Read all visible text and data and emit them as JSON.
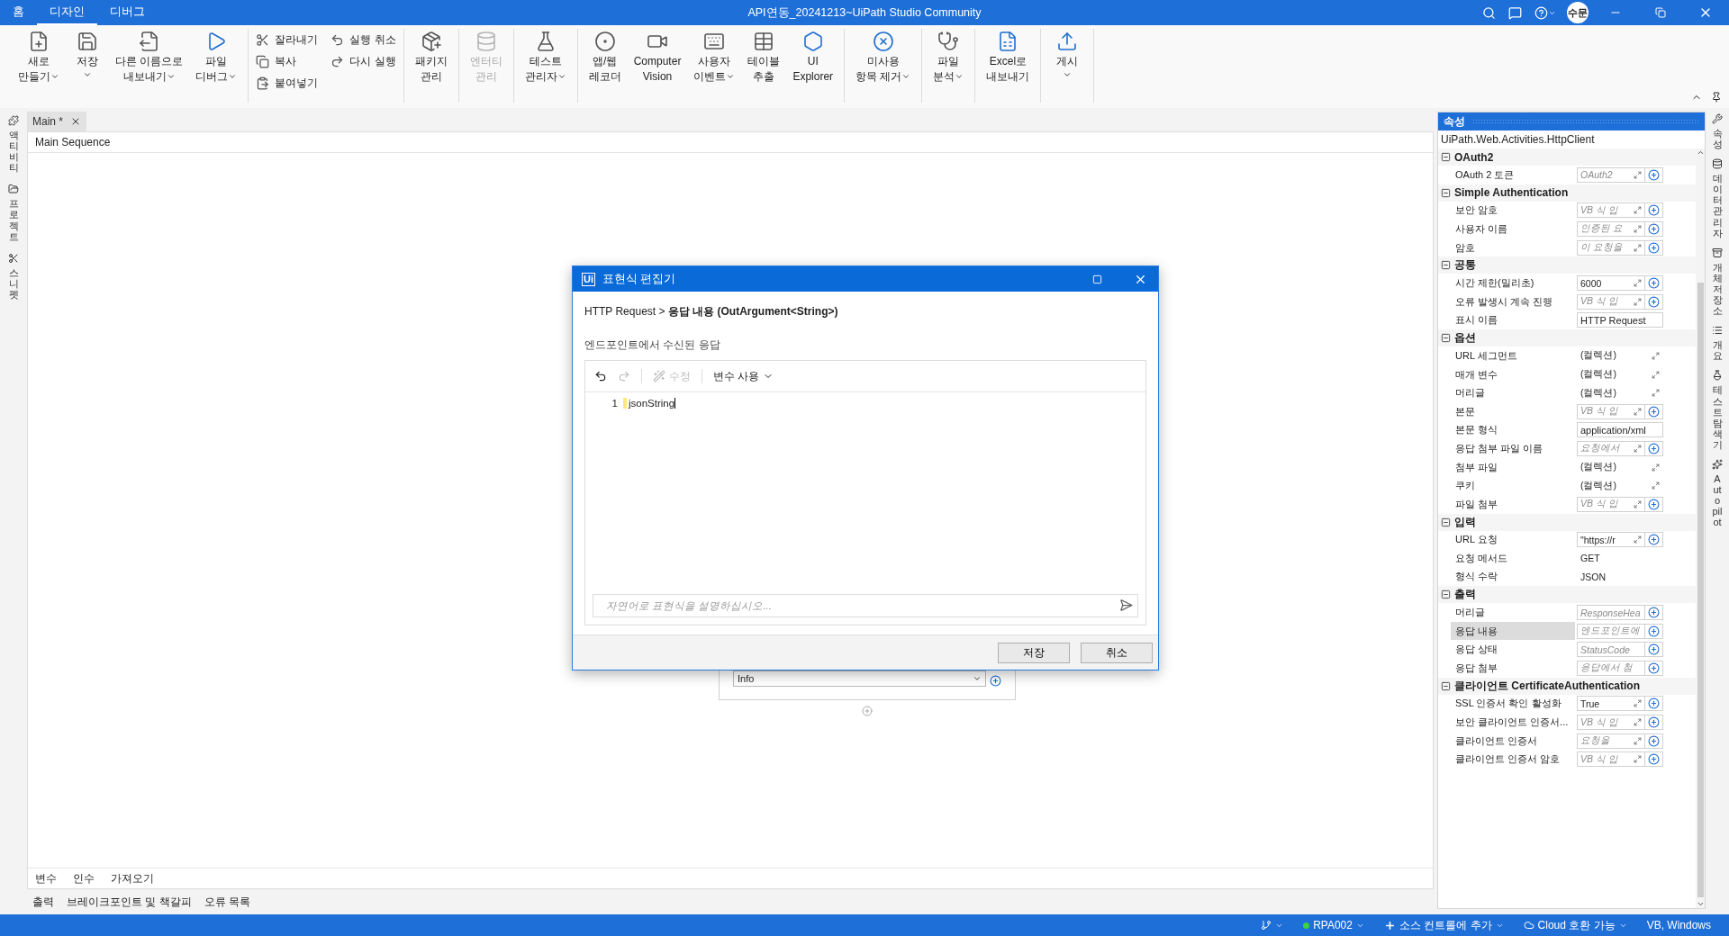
{
  "window": {
    "title": "API연동_20241213~UiPath Studio Community",
    "user": "수문"
  },
  "menu_tabs": [
    {
      "label": "홈",
      "selected": false
    },
    {
      "label": "디자인",
      "selected": true
    },
    {
      "label": "디버그",
      "selected": false
    }
  ],
  "ribbon_groups": [
    {
      "kind": "large",
      "buttons": [
        {
          "lines": [
            "새로",
            "만들기"
          ],
          "caret": true,
          "disabled": false
        },
        {
          "lines": [
            "저장"
          ],
          "caret": true,
          "disabled": false
        },
        {
          "lines": [
            "다른 이름으로",
            "내보내기"
          ],
          "caret": true,
          "disabled": false
        },
        {
          "lines": [
            "파일",
            "디버그"
          ],
          "caret": true,
          "disabled": false
        }
      ]
    },
    {
      "kind": "small",
      "buttons": [
        {
          "label": "잘라내기",
          "disabled": false
        },
        {
          "label": "복사",
          "disabled": false
        },
        {
          "label": "붙여넣기",
          "disabled": false
        },
        {
          "label": "실행 취소",
          "disabled": false
        },
        {
          "label": "다시 실행",
          "disabled": false
        }
      ]
    },
    {
      "kind": "large",
      "buttons": [
        {
          "lines": [
            "패키지",
            "관리"
          ],
          "caret": false,
          "disabled": false
        }
      ]
    },
    {
      "kind": "large",
      "buttons": [
        {
          "lines": [
            "엔터티",
            "관리"
          ],
          "caret": false,
          "disabled": true
        }
      ]
    },
    {
      "kind": "large",
      "buttons": [
        {
          "lines": [
            "테스트",
            "관리자"
          ],
          "caret": true,
          "disabled": false
        }
      ]
    },
    {
      "kind": "large",
      "buttons": [
        {
          "lines": [
            "앱/웹",
            "레코더"
          ],
          "caret": false,
          "disabled": false
        },
        {
          "lines": [
            "Computer",
            "Vision"
          ],
          "caret": false,
          "disabled": false
        },
        {
          "lines": [
            "사용자",
            "이벤트"
          ],
          "caret": true,
          "disabled": false
        },
        {
          "lines": [
            "테이블",
            "추출"
          ],
          "caret": false,
          "disabled": false
        },
        {
          "lines": [
            "UI",
            "Explorer"
          ],
          "caret": false,
          "disabled": false
        }
      ]
    },
    {
      "kind": "large",
      "buttons": [
        {
          "lines": [
            "미사용",
            "항목 제거"
          ],
          "caret": true,
          "disabled": false
        }
      ]
    },
    {
      "kind": "large",
      "buttons": [
        {
          "lines": [
            "파일",
            "분석"
          ],
          "caret": true,
          "disabled": false
        }
      ]
    },
    {
      "kind": "large",
      "buttons": [
        {
          "lines": [
            "Excel로",
            "내보내기"
          ],
          "caret": false,
          "disabled": false
        }
      ]
    },
    {
      "kind": "large",
      "buttons": [
        {
          "lines": [
            "게시"
          ],
          "caret": true,
          "disabled": false
        }
      ]
    }
  ],
  "left_panels": [
    {
      "label": "액티비티"
    },
    {
      "label": "프로젝트"
    },
    {
      "label": "스니펫"
    }
  ],
  "document_tab": {
    "label": "Main *",
    "selected": true
  },
  "breadcrumb": "Main Sequence",
  "activity": {
    "dropdown_value": "Info"
  },
  "designer_tabs": [
    {
      "label": "변수"
    },
    {
      "label": "인수"
    },
    {
      "label": "가져오기"
    }
  ],
  "bottom_tabs": [
    {
      "label": "출력"
    },
    {
      "label": "브레이크포인트 및 책갈피"
    },
    {
      "label": "오류 목록"
    }
  ],
  "dialog": {
    "logo": "Ui",
    "title": "표현식 편집기",
    "path": "HTTP Request  >  **응답 내용 (OutArgument<String>)**",
    "description": "엔드포인트에서 수신된 응답",
    "toolbar": {
      "undo_disabled": false,
      "redo_disabled": true,
      "fix_label": "수정",
      "fix_disabled": true,
      "variables_label": "변수 사용"
    },
    "lines": [
      {
        "number": "1",
        "text": "jsonString"
      }
    ],
    "prompt": {
      "placeholder": "자연어로 표현식을 설명하십시오..."
    },
    "buttons": [
      {
        "label": "저장"
      },
      {
        "label": "취소"
      }
    ]
  },
  "properties": {
    "title": "속성",
    "type_name": "UiPath.Web.Activities.HttpClient",
    "categories": [
      {
        "name": "OAuth2",
        "expanded": true,
        "rows": [
          {
            "name": "OAuth 2 토큰",
            "kind": "field",
            "placeholder": "OAuth2",
            "selected": false
          }
        ]
      },
      {
        "name": "Simple Authentication",
        "expanded": true,
        "rows": [
          {
            "name": "보안 암호",
            "kind": "field",
            "placeholder": "VB 식 입",
            "selected": false
          },
          {
            "name": "사용자 이름",
            "kind": "field",
            "placeholder": "인증된 요",
            "selected": false
          },
          {
            "name": "암호",
            "kind": "field",
            "placeholder": "이 요청을",
            "selected": false
          }
        ]
      },
      {
        "name": "공통",
        "expanded": true,
        "rows": [
          {
            "name": "시간 제한(밀리초)",
            "kind": "field",
            "value": "6000",
            "selected": false
          },
          {
            "name": "오류 발생시 계속 진행",
            "kind": "field",
            "placeholder": "VB 식 입",
            "selected": false
          },
          {
            "name": "표시 이름",
            "kind": "input",
            "value": "HTTP Request",
            "selected": false
          }
        ]
      },
      {
        "name": "옵션",
        "expanded": true,
        "rows": [
          {
            "name": "URL 세그먼트",
            "kind": "collection",
            "value": "(컬렉션)",
            "selected": false
          },
          {
            "name": "매개 변수",
            "kind": "collection",
            "value": "(컬렉션)",
            "selected": false
          },
          {
            "name": "머리글",
            "kind": "collection",
            "value": "(컬렉션)",
            "selected": false
          },
          {
            "name": "본문",
            "kind": "field",
            "placeholder": "VB 식 입",
            "selected": false
          },
          {
            "name": "본문 형식",
            "kind": "input",
            "value": "application/xml",
            "selected": false
          },
          {
            "name": "응답 첨부 파일 이름",
            "kind": "field",
            "placeholder": "요청에서",
            "selected": false
          },
          {
            "name": "첨부 파일",
            "kind": "collection",
            "value": "(컬렉션)",
            "selected": false
          },
          {
            "name": "쿠키",
            "kind": "collection",
            "value": "(컬렉션)",
            "selected": false
          },
          {
            "name": "파일 첨부",
            "kind": "field",
            "placeholder": "VB 식 입",
            "selected": false
          }
        ]
      },
      {
        "name": "입력",
        "expanded": true,
        "rows": [
          {
            "name": "URL 요청",
            "kind": "field",
            "value": "\"https://r",
            "selected": false
          },
          {
            "name": "요청 메서드",
            "kind": "text",
            "value": "GET",
            "selected": false
          },
          {
            "name": "형식 수락",
            "kind": "text",
            "value": "JSON",
            "selected": false
          }
        ]
      },
      {
        "name": "출력",
        "expanded": true,
        "rows": [
          {
            "name": "머리글",
            "kind": "output",
            "placeholder": "ResponseHea",
            "selected": false
          },
          {
            "name": "응답 내용",
            "kind": "output",
            "placeholder": "엔드포인트에",
            "selected": true
          },
          {
            "name": "응답 상태",
            "kind": "output",
            "placeholder": "StatusCode",
            "selected": false
          },
          {
            "name": "응답 첨부",
            "kind": "output",
            "placeholder": "응답에서 첨",
            "selected": false
          }
        ]
      },
      {
        "name": "클라이언트 CertificateAuthentication",
        "expanded": true,
        "rows": [
          {
            "name": "SSL 인증서 확인 활성화",
            "kind": "field",
            "value": "True",
            "selected": false
          },
          {
            "name": "보안 클라이언트 인증서...",
            "kind": "field",
            "placeholder": "VB 식 입",
            "selected": false
          },
          {
            "name": "클라이언트 인증서",
            "kind": "field",
            "placeholder": "요청을",
            "selected": false
          },
          {
            "name": "클라이언트 인증서 암호",
            "kind": "field",
            "placeholder": "VB 식 입",
            "selected": false
          }
        ]
      }
    ]
  },
  "right_panels": [
    {
      "label": "속성"
    },
    {
      "label": "데이터 관리자"
    },
    {
      "label": "개체 저장소"
    },
    {
      "label": "개요"
    },
    {
      "label": "테스트 탐색기"
    },
    {
      "label": "Autopilot"
    }
  ],
  "status_bar": {
    "items": [
      {
        "kind": "git"
      },
      {
        "kind": "robot",
        "label": "RPA002"
      },
      {
        "kind": "source",
        "label": "소스 컨트롤에 추가"
      },
      {
        "kind": "cloud",
        "label": "Cloud 호환 가능"
      },
      {
        "kind": "plain",
        "label": "VB, Windows"
      }
    ]
  }
}
